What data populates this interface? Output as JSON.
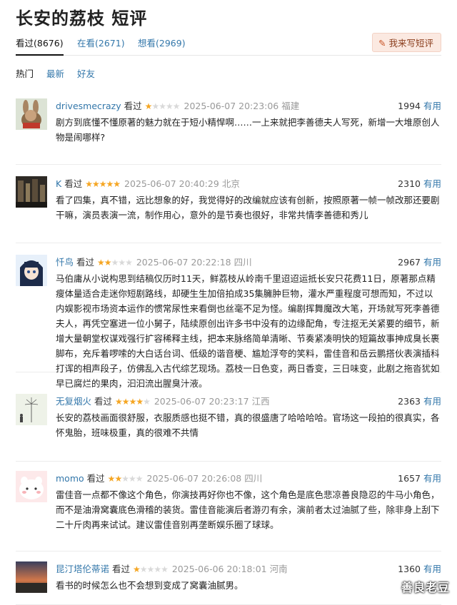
{
  "title": "长安的荔枝 短评",
  "tabs": [
    {
      "label": "看过(8676)",
      "active": true
    },
    {
      "label": "在看(2671)",
      "active": false
    },
    {
      "label": "想看(2969)",
      "active": false
    }
  ],
  "write_button": {
    "label": "我来写短评"
  },
  "sort": [
    "热门",
    "最新",
    "好友"
  ],
  "useful_label": "有用",
  "watched_label": "看过",
  "reviews": [
    {
      "user": "drivesmecrazy",
      "stars": 1,
      "time": "2025-06-07 20:23:06",
      "location": "福建",
      "votes": "1994",
      "text": "剧方到底懂不懂原著的魅力就在于短小精悍啊……一上来就把李善德夫人写死，新增一大堆原创人物是闹哪样?"
    },
    {
      "user": "K",
      "stars": 5,
      "time": "2025-06-07 20:40:29",
      "location": "北京",
      "votes": "2310",
      "text": "看了四集，真不错，远比想象的好，我觉得好的改编就应该有创新，按照原著一帧一帧改那还要剧干嘛，演员表演一流，制作用心，意外的是节奏也很好，非常共情李善德和秀儿"
    },
    {
      "user": "忏鸟",
      "stars": 2,
      "time": "2025-06-07 20:22:18",
      "location": "四川",
      "votes": "2967",
      "text": "马伯庸从小说构思到结稿仅历时11天，鲜荔枝从岭南千里迢迢运抵长安只花费11日，原著那点精瘦体量适合走迷你短剧路线，却硬生生加倍拍成35集臃肿巨物，灌水严重程度可想而知，不过以内娱影视市场资本运作的惯常尿性来看倒也丝毫不足为怪。编剧挥舞魔改大笔，开场就写死李善德夫人，再凭空塞进一位小舅子，陆续原创出许多书中没有的边缘配角，专注抠无关紧要的细节，新增大量朝堂权谋戏强行扩容稀释主线，把本来脉络简单清晰、节奏紧凑明快的短篇故事抻成臭长裹脚布，充斥着啰嗦的大白话台词、低级的谐音梗、尴尬浮夸的笑料，雷佳音和岳云鹏搭伙表演插科打诨的相声段子，仿佛乱入古代综艺现场。荔枝一日色变，两日香变，三日味变，此剧之拖沓犹如早已腐烂的果肉，汩汩流出腥臭汁液。"
    },
    {
      "user": "无复烟火",
      "stars": 4,
      "time": "2025-06-07 20:23:17",
      "location": "江西",
      "votes": "2363",
      "text": "长安的荔枝画面很舒服，衣服质感也挺不错，真的很盛唐了哈哈哈哈。官场这一段拍的很真实，各怀鬼胎，班味极重，真的很难不共情"
    },
    {
      "user": "momo",
      "stars": 2,
      "time": "2025-06-07 20:26:08",
      "location": "四川",
      "votes": "1657",
      "text": "雷佳音一点都不像这个角色，你演技再好你也不像，这个角色是底色悲凉善良隐忍的牛马小角色，而不是油滑窝囊底色滑稽的装货。雷佳音能演后者游刃有余，演前者太过油腻了些，除非身上刮下二十斤肉再来试试。建议雷佳音别再垄断娱乐圈了球球。"
    },
    {
      "user": "昆汀塔伦蒂诺",
      "stars": 1,
      "time": "2025-06-06 20:18:01",
      "location": "河南",
      "votes": "1360",
      "text": "看书的时候怎么也不会想到变成了窝囊油腻男。"
    }
  ],
  "watermark": "善良老豆",
  "colors": {
    "link": "#3377aa",
    "star": "#f5a623",
    "star_empty": "#d9d9d9",
    "write_bg": "#fbe9e1"
  }
}
